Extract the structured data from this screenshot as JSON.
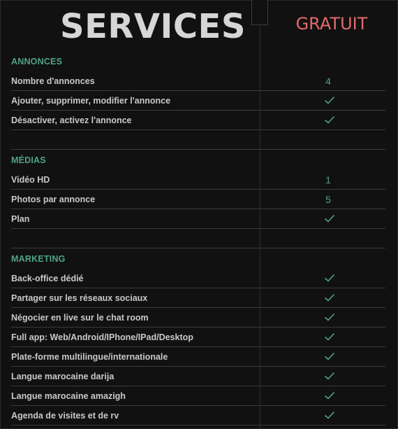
{
  "header": {
    "title": "SERVICES",
    "plan": "GRATUIT"
  },
  "colors": {
    "accent_green": "#4fa485",
    "plan_red": "#e46a68",
    "text": "#c9c9c9",
    "background": "#111111"
  },
  "sections": [
    {
      "title": "ANNONCES",
      "rows": [
        {
          "label": "Nombre d'annonces",
          "value": "4"
        },
        {
          "label": "Ajouter, supprimer, modifier l'annonce",
          "value": "check-icon"
        },
        {
          "label": "Désactiver, activez l'annonce",
          "value": "check-icon"
        }
      ]
    },
    {
      "title": "MÉDIAS",
      "rows": [
        {
          "label": "Vidéo HD",
          "value": "1"
        },
        {
          "label": "Photos par annonce",
          "value": "5"
        },
        {
          "label": "Plan",
          "value": "check-icon"
        }
      ]
    },
    {
      "title": "MARKETING",
      "rows": [
        {
          "label": "Back-office dédié",
          "value": "check-icon"
        },
        {
          "label": "Partager sur les réseaux sociaux",
          "value": "check-icon"
        },
        {
          "label": "Négocier en live sur le chat room",
          "value": "check-icon"
        },
        {
          "label": "Full app: Web/Android/IPhone/IPad/Desktop",
          "value": "check-icon"
        },
        {
          "label": "Plate-forme multilingue/internationale",
          "value": "check-icon"
        },
        {
          "label": "Langue marocaine darija",
          "value": "check-icon"
        },
        {
          "label": "Langue marocaine  amazigh",
          "value": "check-icon"
        },
        {
          "label": "Agenda de visites et de rv",
          "value": "check-icon"
        }
      ]
    }
  ]
}
